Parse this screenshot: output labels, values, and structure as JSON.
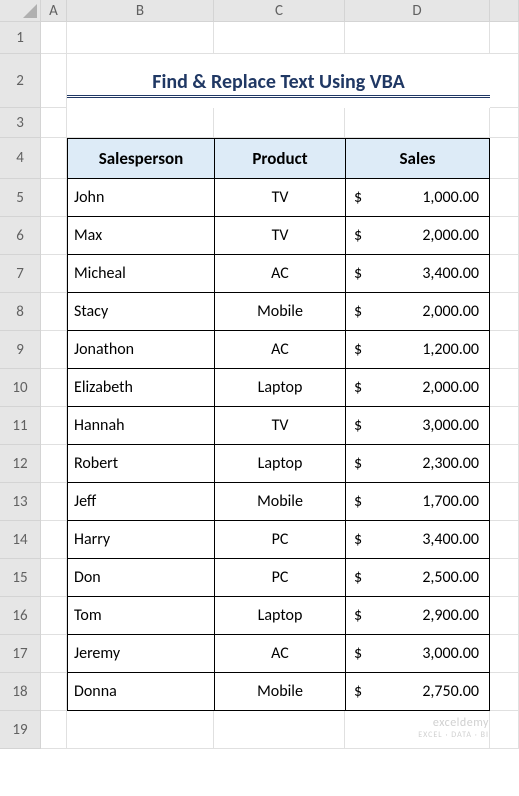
{
  "columns": [
    "A",
    "B",
    "C",
    "D"
  ],
  "row_numbers": [
    1,
    2,
    3,
    4,
    5,
    6,
    7,
    8,
    9,
    10,
    11,
    12,
    13,
    14,
    15,
    16,
    17,
    18,
    19
  ],
  "title": "Find & Replace Text Using VBA",
  "headers": {
    "salesperson": "Salesperson",
    "product": "Product",
    "sales": "Sales"
  },
  "currency": "$",
  "rows": [
    {
      "salesperson": "John",
      "product": "TV",
      "sales": "1,000.00"
    },
    {
      "salesperson": "Max",
      "product": "TV",
      "sales": "2,000.00"
    },
    {
      "salesperson": "Micheal",
      "product": "AC",
      "sales": "3,400.00"
    },
    {
      "salesperson": "Stacy",
      "product": "Mobile",
      "sales": "2,000.00"
    },
    {
      "salesperson": "Jonathon",
      "product": "AC",
      "sales": "1,200.00"
    },
    {
      "salesperson": "Elizabeth",
      "product": "Laptop",
      "sales": "2,000.00"
    },
    {
      "salesperson": "Hannah",
      "product": "TV",
      "sales": "3,000.00"
    },
    {
      "salesperson": "Robert",
      "product": "Laptop",
      "sales": "2,300.00"
    },
    {
      "salesperson": "Jeff",
      "product": "Mobile",
      "sales": "1,700.00"
    },
    {
      "salesperson": "Harry",
      "product": "PC",
      "sales": "3,400.00"
    },
    {
      "salesperson": "Don",
      "product": "PC",
      "sales": "2,500.00"
    },
    {
      "salesperson": "Tom",
      "product": "Laptop",
      "sales": "2,900.00"
    },
    {
      "salesperson": "Jeremy",
      "product": "AC",
      "sales": "3,000.00"
    },
    {
      "salesperson": "Donna",
      "product": "Mobile",
      "sales": "2,750.00"
    }
  ],
  "watermark": {
    "main": "exceldemy",
    "sub": "EXCEL · DATA · BI"
  },
  "chart_data": {
    "type": "table",
    "title": "Find & Replace Text Using VBA",
    "columns": [
      "Salesperson",
      "Product",
      "Sales"
    ],
    "data": [
      [
        "John",
        "TV",
        1000.0
      ],
      [
        "Max",
        "TV",
        2000.0
      ],
      [
        "Micheal",
        "AC",
        3400.0
      ],
      [
        "Stacy",
        "Mobile",
        2000.0
      ],
      [
        "Jonathon",
        "AC",
        1200.0
      ],
      [
        "Elizabeth",
        "Laptop",
        2000.0
      ],
      [
        "Hannah",
        "TV",
        3000.0
      ],
      [
        "Robert",
        "Laptop",
        2300.0
      ],
      [
        "Jeff",
        "Mobile",
        1700.0
      ],
      [
        "Harry",
        "PC",
        3400.0
      ],
      [
        "Don",
        "PC",
        2500.0
      ],
      [
        "Tom",
        "Laptop",
        2900.0
      ],
      [
        "Jeremy",
        "AC",
        3000.0
      ],
      [
        "Donna",
        "Mobile",
        2750.0
      ]
    ]
  }
}
